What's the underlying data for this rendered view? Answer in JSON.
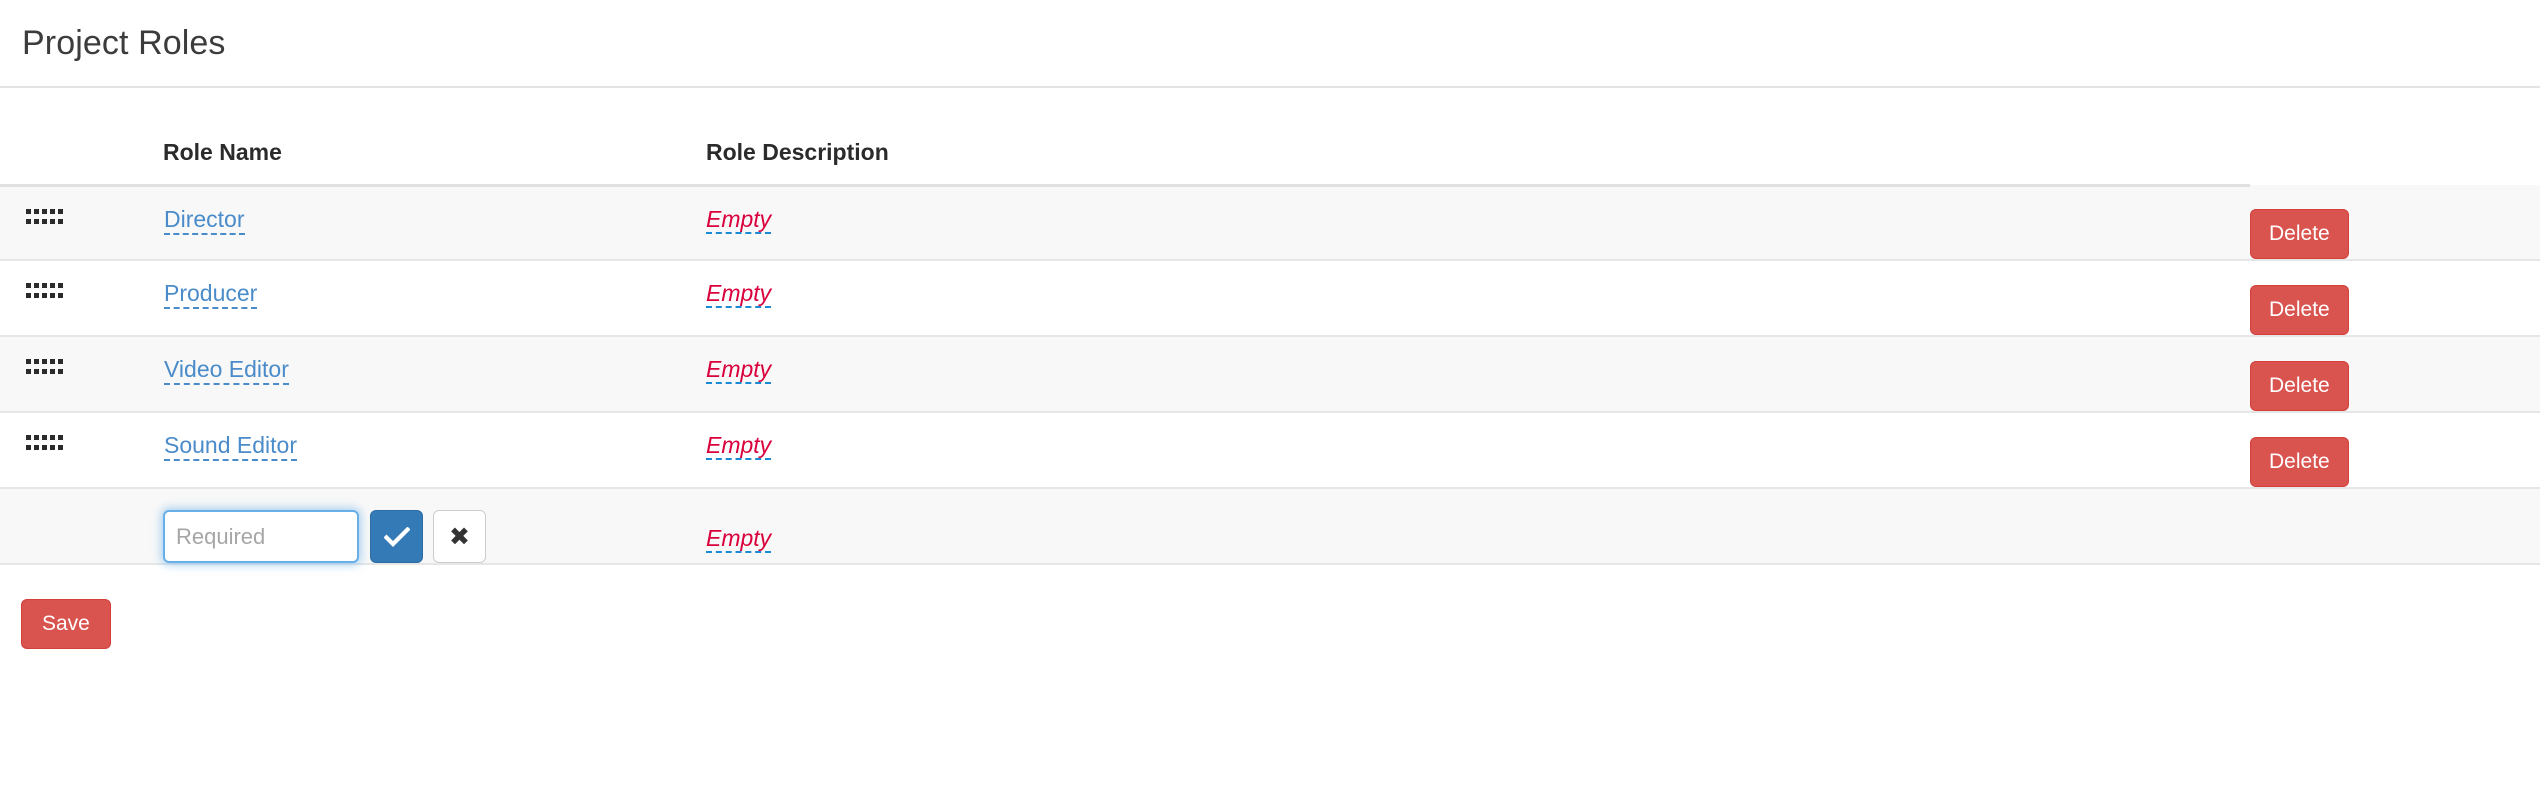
{
  "header": {
    "title": "Project Roles"
  },
  "table": {
    "columns": [
      {
        "key": "handle",
        "label": ""
      },
      {
        "key": "name",
        "label": "Role Name"
      },
      {
        "key": "desc",
        "label": "Role Description"
      },
      {
        "key": "action",
        "label": ""
      }
    ],
    "rows": [
      {
        "handle": "drag-handle-icon",
        "name": "Director",
        "description": "Empty",
        "delete_label": "Delete"
      },
      {
        "handle": "drag-handle-icon",
        "name": "Producer",
        "description": "Empty",
        "delete_label": "Delete"
      },
      {
        "handle": "drag-handle-icon",
        "name": "Video Editor",
        "description": "Empty",
        "delete_label": "Delete"
      },
      {
        "handle": "drag-handle-icon",
        "name": "Sound Editor",
        "description": "Empty",
        "delete_label": "Delete"
      }
    ],
    "new_row": {
      "input_value": "",
      "input_placeholder": "Required",
      "confirm_icon": "check-icon",
      "cancel_icon": "close-icon",
      "description": "Empty"
    }
  },
  "footer": {
    "save_label": "Save"
  },
  "colors": {
    "link": "#4a8bc9",
    "empty_text": "#d9003c",
    "dashed_underline": "#1b8ad4",
    "danger": "#d9534f",
    "primary": "#337ab7",
    "focus_border": "#66afe9",
    "row_stripe": "#f8f8f8",
    "divider": "#e3e3e3"
  }
}
